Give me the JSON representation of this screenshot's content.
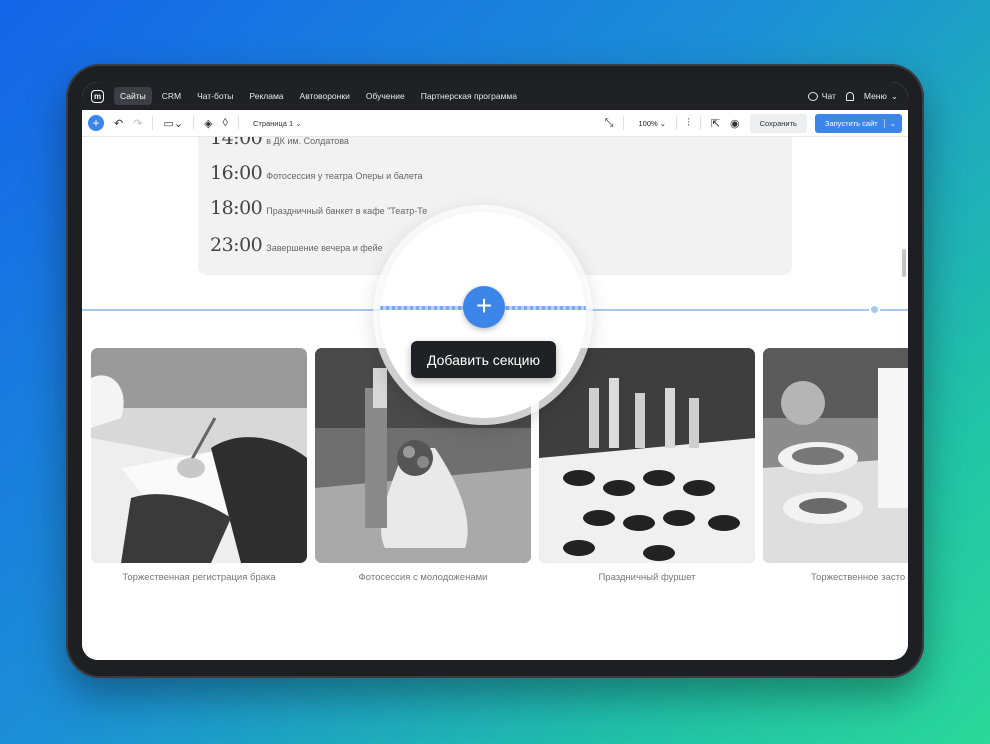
{
  "topnav": {
    "items": [
      {
        "label": "Сайты",
        "active": true
      },
      {
        "label": "CRM"
      },
      {
        "label": "Чат-боты"
      },
      {
        "label": "Реклама"
      },
      {
        "label": "Автоворонки"
      },
      {
        "label": "Обучение"
      },
      {
        "label": "Партнерская программа"
      }
    ],
    "chat_label": "Чат",
    "menu_label": "Меню"
  },
  "toolbar": {
    "page_select": "Страница 1",
    "zoom": "100%",
    "save_label": "Сохранить",
    "launch_label": "Запустить сайт"
  },
  "schedule": [
    {
      "time": "14:00",
      "desc": "в ДК им. Солдатова"
    },
    {
      "time": "16:00",
      "desc": "Фотосессия у театра Оперы и балета"
    },
    {
      "time": "18:00",
      "desc": "Праздничный банкет в кафе \"Театр-Те"
    },
    {
      "time": "23:00",
      "desc": "Завершение вечера и фейе"
    }
  ],
  "add_section_tooltip": "Добавить секцию",
  "cards": [
    {
      "caption": "Торжественная регистрация брака",
      "icon": "signing-photo"
    },
    {
      "caption": "Фотосессия с молодоженами",
      "icon": "bride-photo"
    },
    {
      "caption": "Праздничный фуршет",
      "icon": "buffet-photo"
    },
    {
      "caption": "Торжественное засто",
      "icon": "banquet-photo"
    }
  ],
  "colors": {
    "accent": "#3b86e8",
    "nav_bg": "#1f2124"
  }
}
